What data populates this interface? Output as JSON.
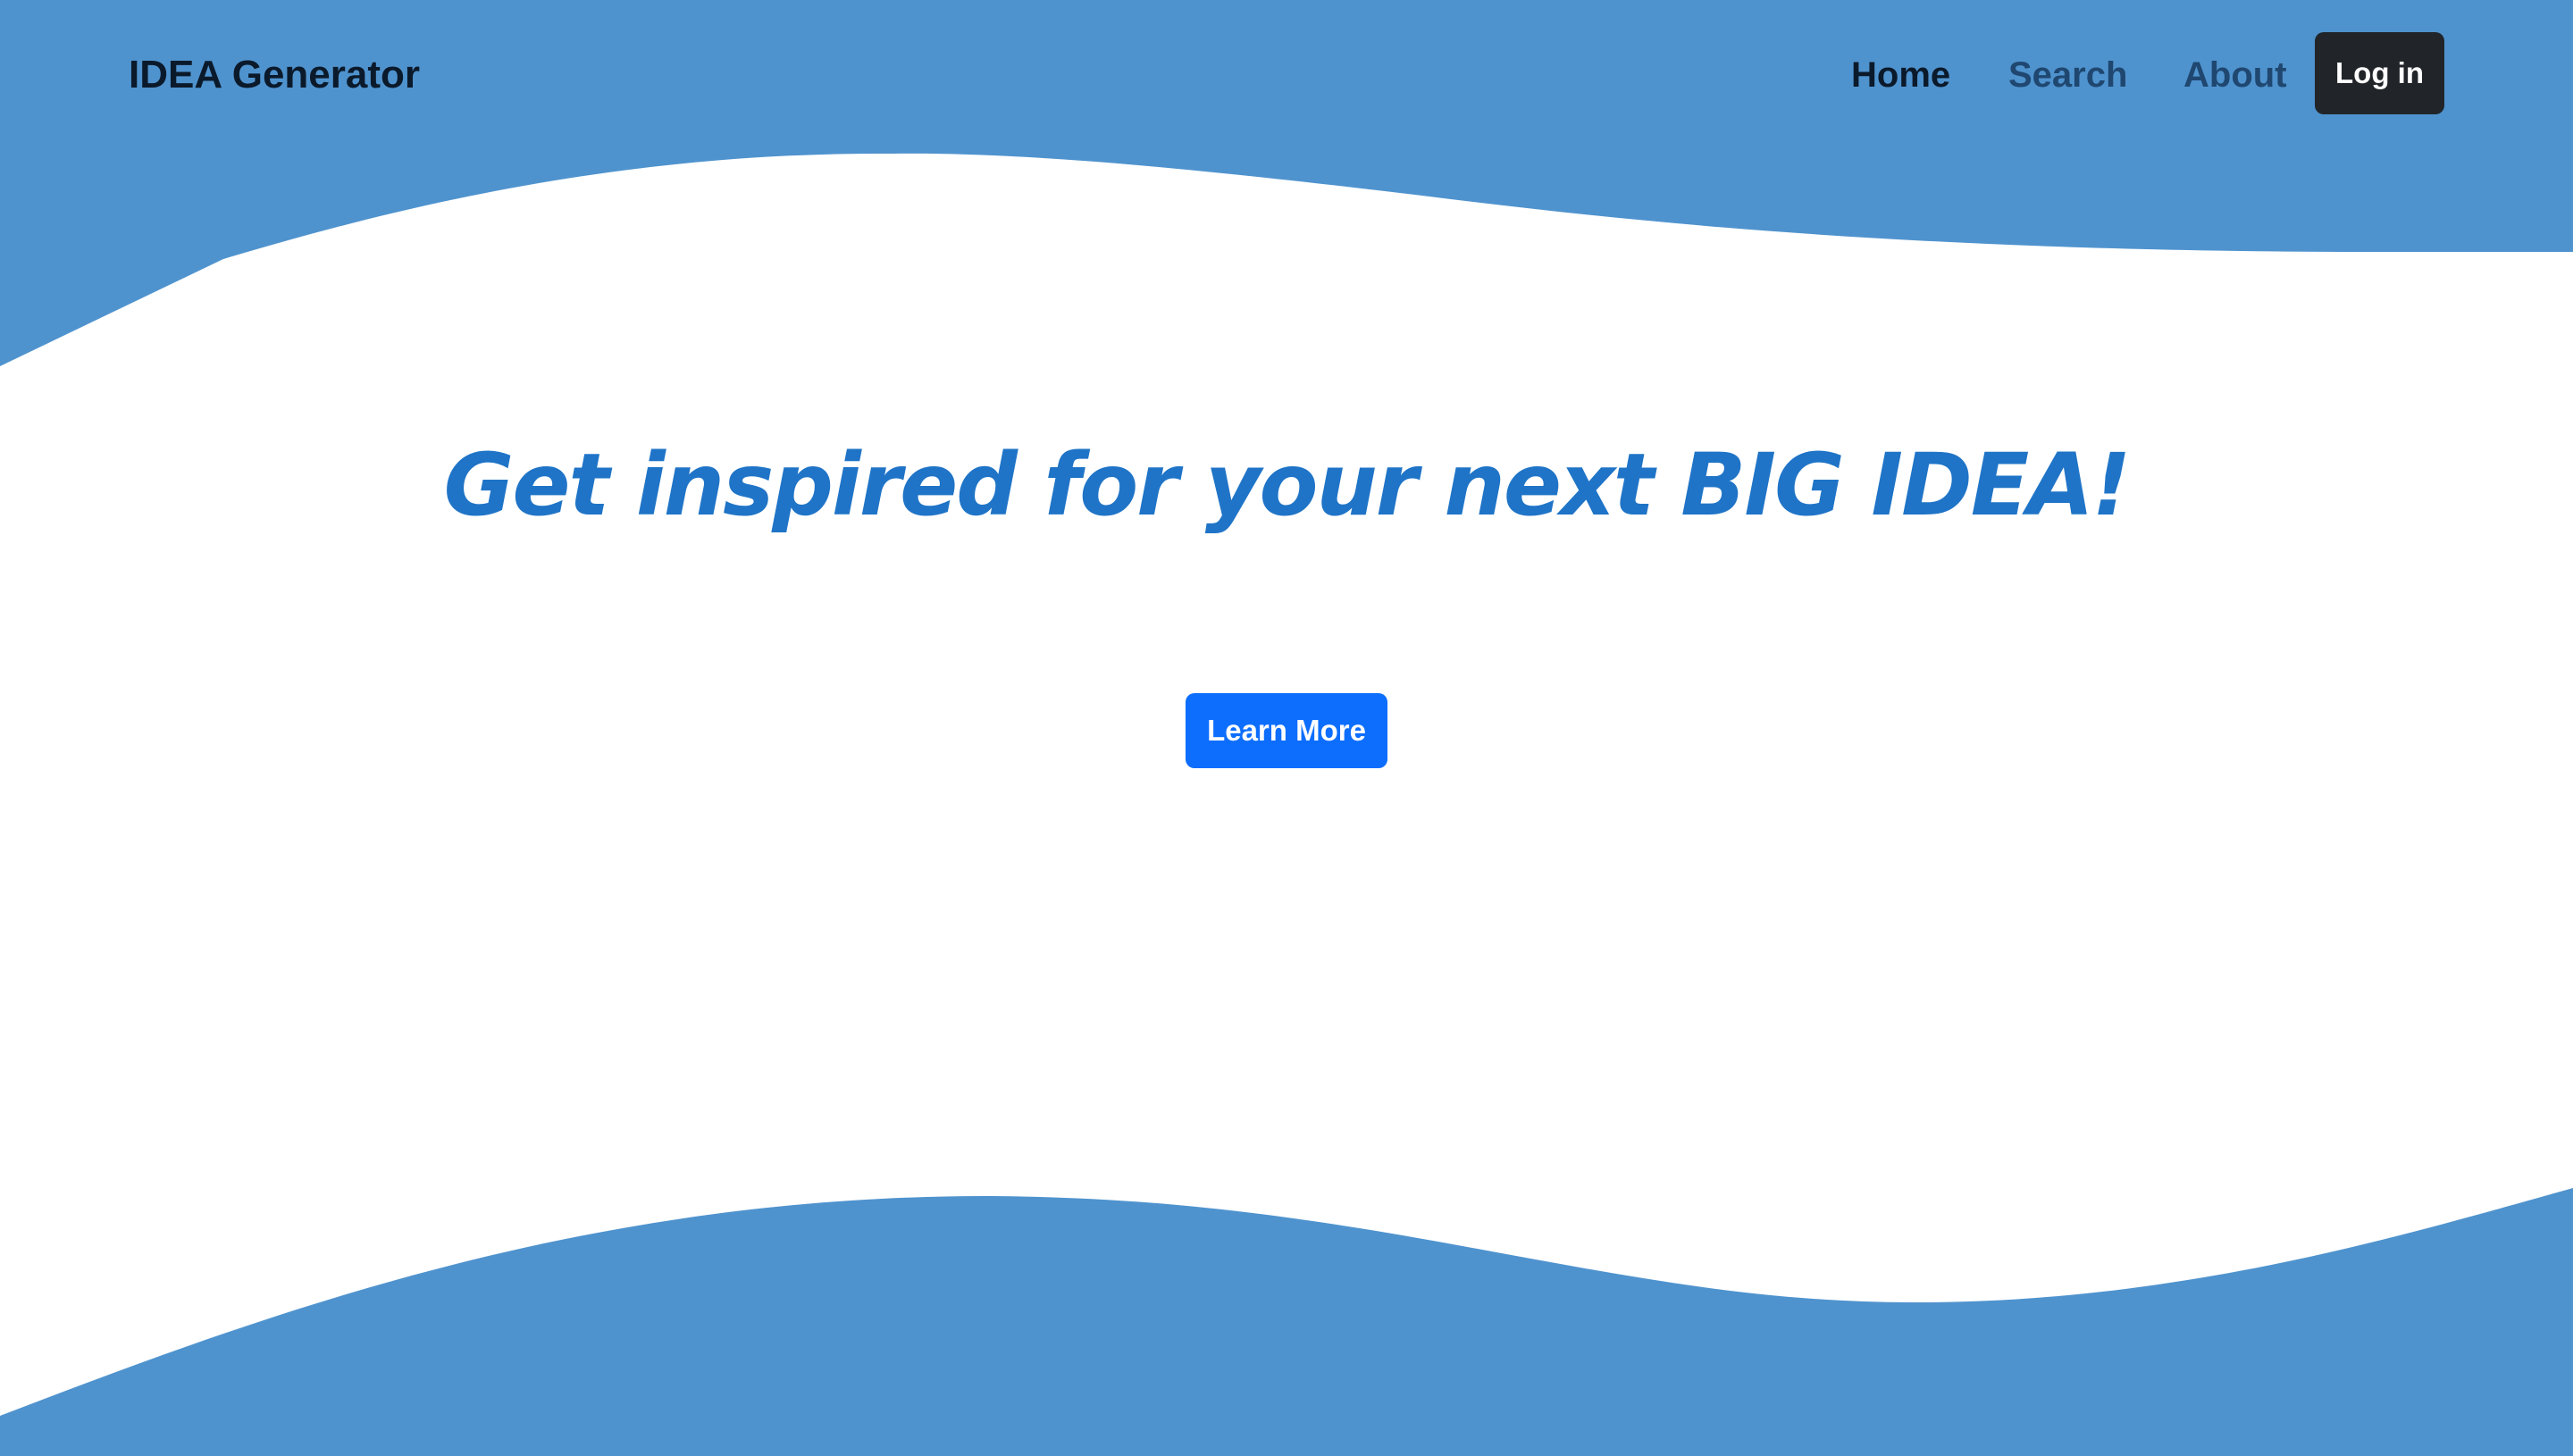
{
  "colors": {
    "wave": "#4f93ce",
    "background": "#ffffff",
    "brand_text": "#0b1a2b",
    "nav_active": "#0b1a2b",
    "nav_inactive": "#1f4770",
    "login_bg": "#212529",
    "hero_title": "#1f74c7",
    "primary_button": "#0d6efd"
  },
  "navbar": {
    "brand": "IDEA Generator",
    "links": [
      {
        "label": "Home",
        "active": true
      },
      {
        "label": "Search",
        "active": false
      },
      {
        "label": "About",
        "active": false
      }
    ],
    "login_label": "Log in"
  },
  "hero": {
    "title": "Get inspired for your next BIG IDEA!",
    "cta_label": "Learn More"
  }
}
